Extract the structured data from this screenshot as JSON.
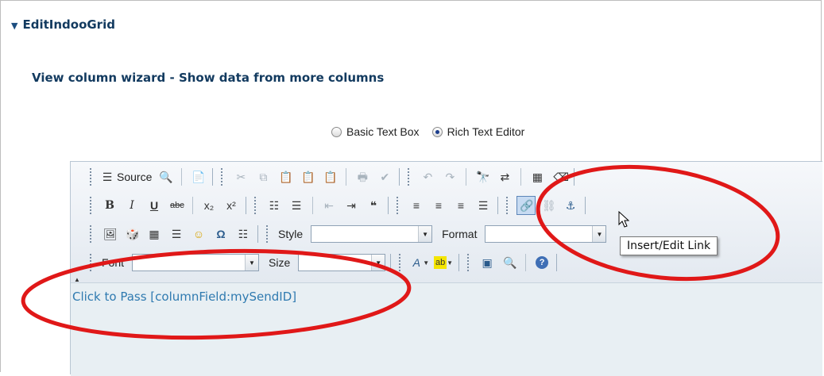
{
  "section": {
    "title": "EditIndooGrid"
  },
  "wizard": {
    "title": "View column wizard - Show data from more columns"
  },
  "editor_mode": {
    "options": [
      {
        "label": "Basic Text Box",
        "selected": false
      },
      {
        "label": "Rich Text Editor",
        "selected": true
      }
    ]
  },
  "toolbar": {
    "source_label": "Source",
    "style_label": "Style",
    "format_label": "Format",
    "font_label": "Font",
    "size_label": "Size",
    "style_value": "",
    "format_value": "",
    "font_value": "",
    "size_value": ""
  },
  "content": {
    "text": "Click to Pass [columnField:mySendID]"
  },
  "tooltip": {
    "text": "Insert/Edit Link"
  },
  "colors": {
    "heading": "#123a5f",
    "link_text": "#2f7ab0",
    "annotation": "#e01818",
    "active_button": "#c7dbf2"
  }
}
